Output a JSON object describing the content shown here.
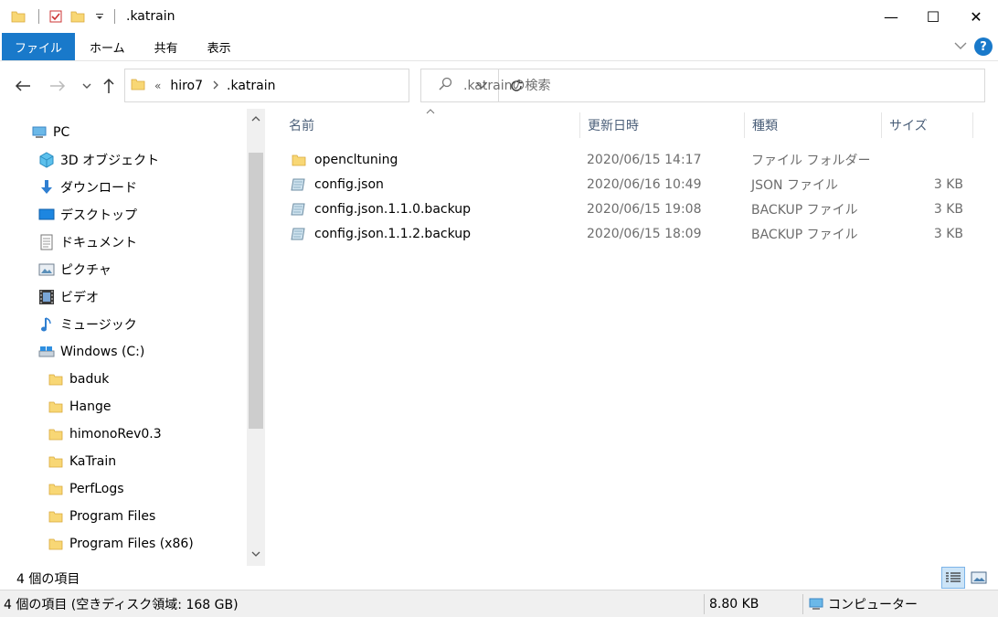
{
  "window": {
    "title": ".katrain",
    "minimize_glyph": "—",
    "maximize_glyph": "☐",
    "close_glyph": "✕"
  },
  "ribbon": {
    "tabs": [
      "ファイル",
      "ホーム",
      "共有",
      "表示"
    ],
    "accent": "#1979ca",
    "help_glyph": "?"
  },
  "address": {
    "overflow": "«",
    "crumbs": [
      "hiro7",
      ".katrain"
    ],
    "search_placeholder": ".katrainの検索"
  },
  "nav": {
    "items": [
      {
        "label": "PC",
        "icon": "pc-icon"
      },
      {
        "label": "3D オブジェクト",
        "icon": "3d-objects-icon"
      },
      {
        "label": "ダウンロード",
        "icon": "download-icon"
      },
      {
        "label": "デスクトップ",
        "icon": "desktop-icon"
      },
      {
        "label": "ドキュメント",
        "icon": "document-icon"
      },
      {
        "label": "ピクチャ",
        "icon": "pictures-icon"
      },
      {
        "label": "ビデオ",
        "icon": "video-icon"
      },
      {
        "label": "ミュージック",
        "icon": "music-icon"
      },
      {
        "label": "Windows (C:)",
        "icon": "drive-icon"
      },
      {
        "label": "baduk",
        "icon": "folder-icon"
      },
      {
        "label": "Hange",
        "icon": "folder-icon"
      },
      {
        "label": "himonoRev0.3",
        "icon": "folder-icon"
      },
      {
        "label": "KaTrain",
        "icon": "folder-icon"
      },
      {
        "label": "PerfLogs",
        "icon": "folder-icon"
      },
      {
        "label": "Program Files",
        "icon": "folder-icon"
      },
      {
        "label": "Program Files (x86)",
        "icon": "folder-icon"
      }
    ]
  },
  "files": {
    "columns": [
      "名前",
      "更新日時",
      "種類",
      "サイズ"
    ],
    "rows": [
      {
        "name": "opencltuning",
        "date": "2020/06/15 14:17",
        "type": "ファイル フォルダー",
        "size": "",
        "icon": "folder-icon"
      },
      {
        "name": "config.json",
        "date": "2020/06/16 10:49",
        "type": "JSON ファイル",
        "size": "3 KB",
        "icon": "file-icon"
      },
      {
        "name": "config.json.1.1.0.backup",
        "date": "2020/06/15 19:08",
        "type": "BACKUP ファイル",
        "size": "3 KB",
        "icon": "file-icon"
      },
      {
        "name": "config.json.1.1.2.backup",
        "date": "2020/06/15 18:09",
        "type": "BACKUP ファイル",
        "size": "3 KB",
        "icon": "file-icon"
      }
    ]
  },
  "status": {
    "item_count": "4 個の項目",
    "free_space": "4 個の項目 (空きディスク領域: 168 GB)",
    "size": "8.80 KB",
    "location": "コンピューター"
  }
}
